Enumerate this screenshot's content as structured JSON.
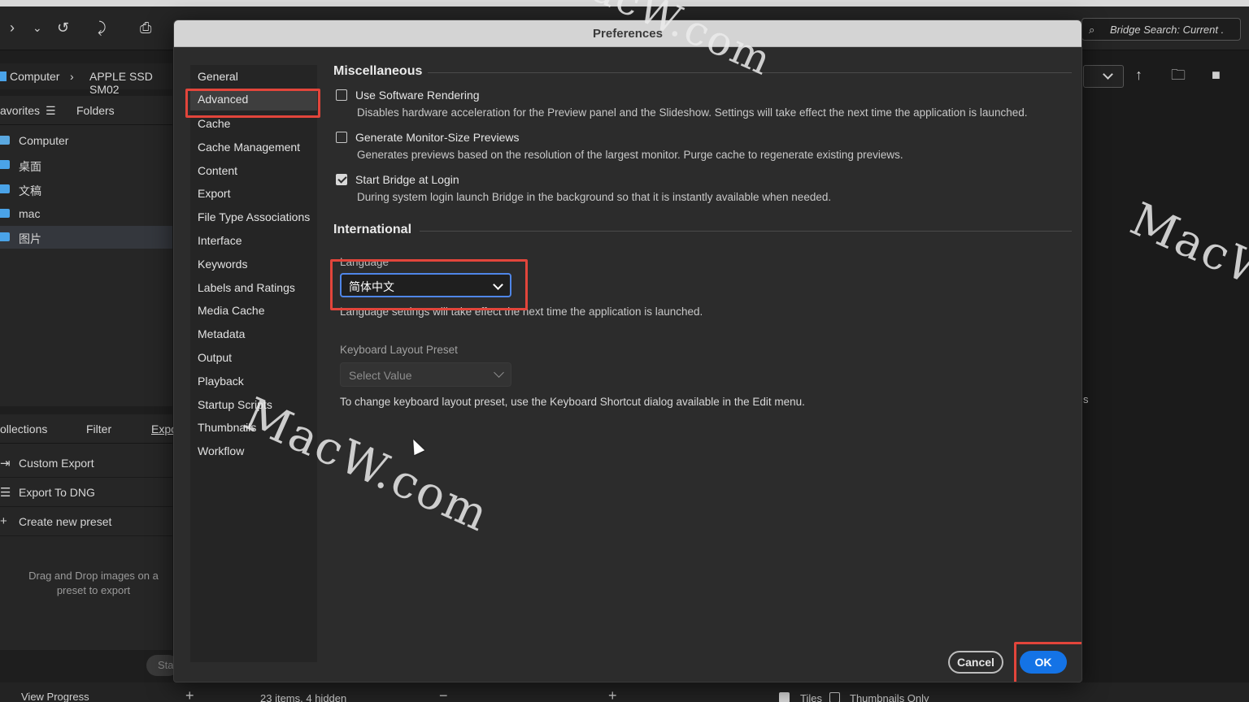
{
  "app": {
    "search_placeholder": "Bridge Search: Current .",
    "path": [
      "Computer",
      "APPLE SSD SM02"
    ],
    "left_tabs": [
      "avorites",
      "Folders"
    ],
    "favorites": [
      "Computer",
      "桌面",
      "文稿",
      "mac",
      "图片"
    ],
    "lower_tabs": [
      "ollections",
      "Filter",
      "Expo"
    ],
    "export_items": [
      "Custom Export",
      "Export To DNG",
      "Create new preset"
    ],
    "export_hint": "Drag and Drop images on a preset to export",
    "start_btn": "Sta",
    "view_progress": "View Progress",
    "items_status": "23 items, 4 hidden",
    "tiles_label": "Tiles",
    "thumbs_only_label": "Thumbnails Only",
    "right_fragment": "s"
  },
  "dialog": {
    "title": "Preferences",
    "categories": [
      "General",
      "Advanced",
      "Cache",
      "Cache Management",
      "Content",
      "Export",
      "File Type Associations",
      "Interface",
      "Keywords",
      "Labels and Ratings",
      "Media Cache",
      "Metadata",
      "Output",
      "Playback",
      "Startup Scripts",
      "Thumbnails",
      "Workflow"
    ],
    "selected_category": "Advanced",
    "misc": {
      "heading": "Miscellaneous",
      "options": [
        {
          "label": "Use Software Rendering",
          "desc": "Disables hardware acceleration for the Preview panel and the Slideshow. Settings will take effect the next time the application is launched.",
          "checked": false
        },
        {
          "label": "Generate Monitor-Size Previews",
          "desc": "Generates previews based on the resolution of the largest monitor.  Purge cache to regenerate existing previews.",
          "checked": false
        },
        {
          "label": "Start Bridge at Login",
          "desc": "During system login launch Bridge in the background so that it is instantly available when needed.",
          "checked": true
        }
      ]
    },
    "intl": {
      "heading": "International",
      "language_label": "Language",
      "language_value": "简体中文",
      "language_note": "Language settings will take effect the next time the application is launched.",
      "kbd_label": "Keyboard Layout Preset",
      "kbd_value": "Select Value",
      "kbd_note": "To change keyboard layout preset, use the Keyboard Shortcut dialog available in the Edit menu."
    },
    "cancel": "Cancel",
    "ok": "OK"
  },
  "watermark": "MacW.com",
  "colors": {
    "highlight": "#e2453b",
    "accent": "#1473e6",
    "folder": "#4aa3e8"
  }
}
